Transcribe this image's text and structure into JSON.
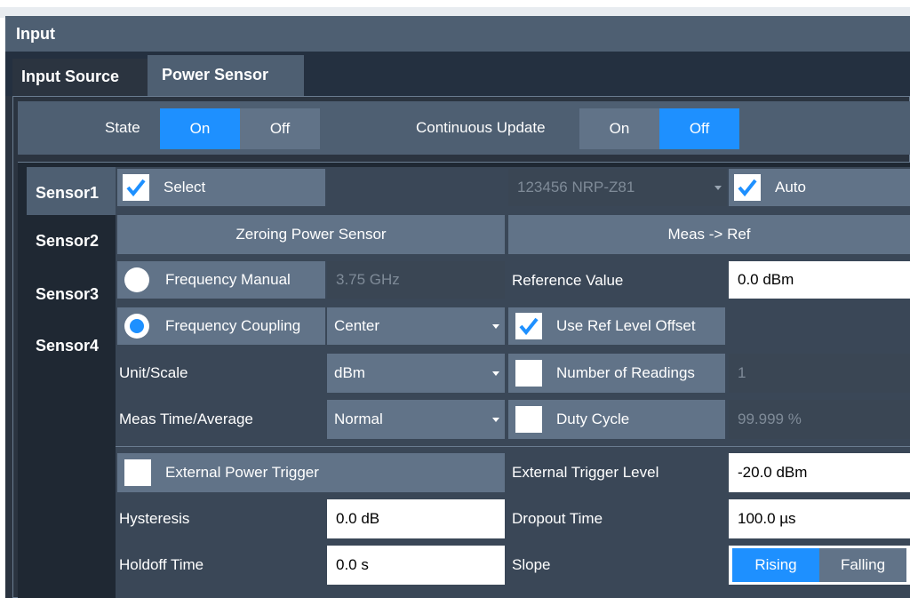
{
  "window": {
    "title": "Input"
  },
  "tabs": [
    {
      "label": "Input Source"
    },
    {
      "label": "Power Sensor"
    }
  ],
  "state": {
    "label": "State",
    "on": "On",
    "off": "Off"
  },
  "continuous_update": {
    "label": "Continuous Update",
    "on": "On",
    "off": "Off"
  },
  "sensors": [
    {
      "label": "Sensor1"
    },
    {
      "label": "Sensor2"
    },
    {
      "label": "Sensor3"
    },
    {
      "label": "Sensor4"
    }
  ],
  "select": {
    "label": "Select"
  },
  "sensor_device": {
    "value": "123456 NRP-Z81"
  },
  "auto": {
    "label": "Auto"
  },
  "zeroing": {
    "label": "Zeroing Power Sensor"
  },
  "meas_ref": {
    "label": "Meas -> Ref"
  },
  "frequency_manual": {
    "label": "Frequency Manual",
    "value": "3.75 GHz"
  },
  "reference_value": {
    "label": "Reference Value",
    "value": "0.0 dBm"
  },
  "frequency_coupling": {
    "label": "Frequency Coupling",
    "value": "Center"
  },
  "use_ref_level_offset": {
    "label": "Use Ref Level Offset"
  },
  "unit_scale": {
    "label": "Unit/Scale",
    "value": "dBm"
  },
  "number_of_readings": {
    "label": "Number of Readings",
    "value": "1"
  },
  "meas_time": {
    "label": "Meas Time/Average",
    "value": "Normal"
  },
  "duty_cycle": {
    "label": "Duty Cycle",
    "value": "99.999 %"
  },
  "external_power_trigger": {
    "label": "External Power Trigger"
  },
  "external_trigger_level": {
    "label": "External Trigger Level",
    "value": "-20.0 dBm"
  },
  "hysteresis": {
    "label": "Hysteresis",
    "value": "0.0 dB"
  },
  "dropout_time": {
    "label": "Dropout Time",
    "value": "100.0 µs"
  },
  "holdoff_time": {
    "label": "Holdoff Time",
    "value": "0.0 s"
  },
  "slope": {
    "label": "Slope",
    "rising": "Rising",
    "falling": "Falling"
  },
  "colors": {
    "accent": "#1e90ff",
    "panel": "#4e5f72",
    "button": "#617388",
    "background": "#2b3440"
  }
}
